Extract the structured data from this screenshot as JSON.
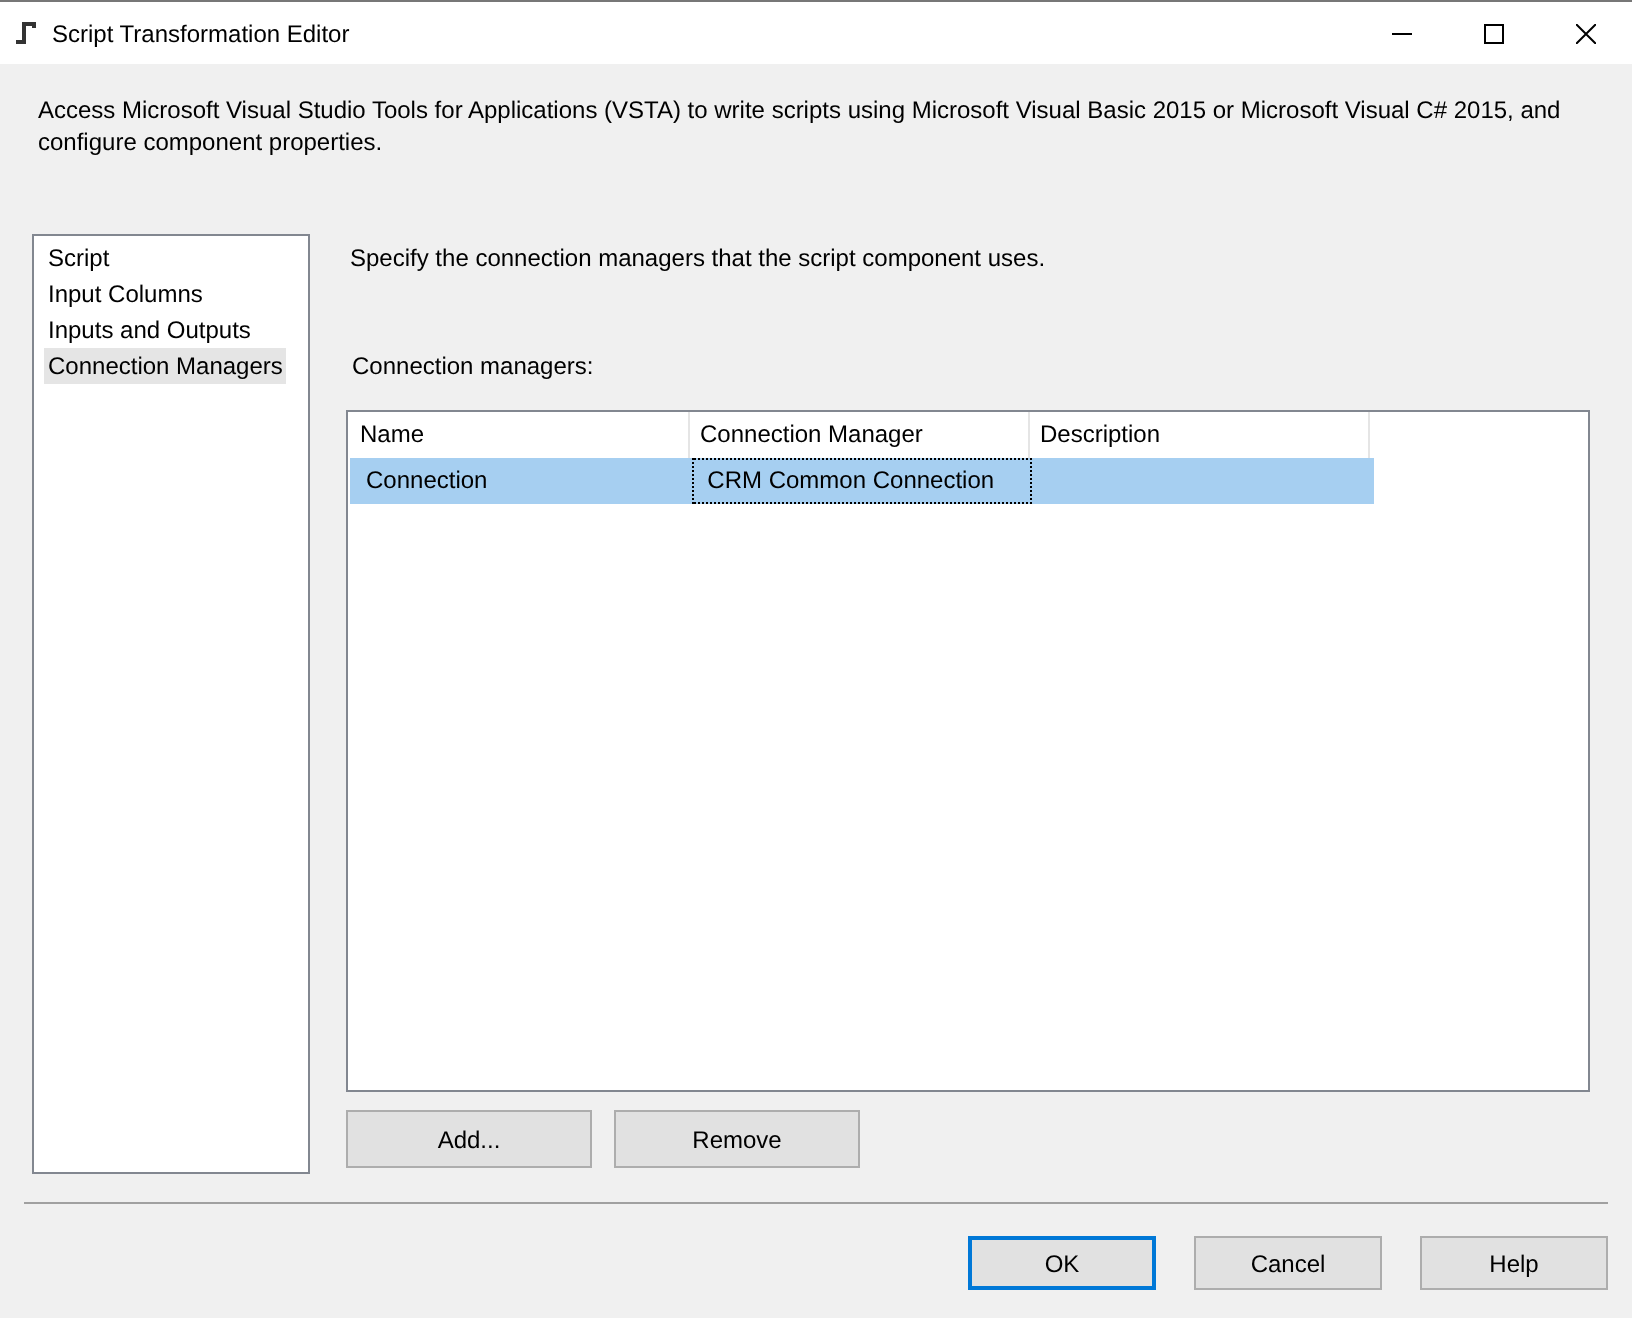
{
  "window": {
    "title": "Script Transformation Editor"
  },
  "description": "Access Microsoft Visual Studio Tools for Applications (VSTA) to write scripts using Microsoft Visual Basic 2015 or Microsoft Visual C# 2015, and configure component properties.",
  "sidebar": {
    "items": [
      {
        "label": "Script",
        "selected": false
      },
      {
        "label": "Input Columns",
        "selected": false
      },
      {
        "label": "Inputs and Outputs",
        "selected": false
      },
      {
        "label": "Connection Managers",
        "selected": true
      }
    ]
  },
  "page": {
    "instruction": "Specify the connection managers that the script component uses.",
    "list_label": "Connection managers:"
  },
  "table": {
    "columns": [
      "Name",
      "Connection Manager",
      "Description"
    ],
    "rows": [
      {
        "selected": true,
        "cells": [
          {
            "text": "Connection",
            "focused": false
          },
          {
            "text": "CRM Common Connection",
            "focused": true
          },
          {
            "text": "",
            "focused": false
          }
        ]
      }
    ]
  },
  "table_buttons": [
    "Add...",
    "Remove"
  ],
  "dialog_buttons": [
    {
      "label": "OK",
      "default": true
    },
    {
      "label": "Cancel",
      "default": false
    },
    {
      "label": "Help",
      "default": false
    }
  ]
}
